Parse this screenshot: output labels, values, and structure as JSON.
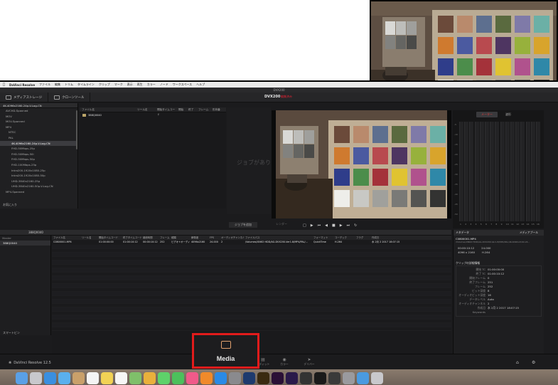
{
  "menubar": {
    "app": "DaVinci Resolve",
    "items": [
      "ファイル",
      "編集",
      "トリム",
      "タイムライン",
      "クリップ",
      "マーク",
      "表示",
      "再生",
      "カラー",
      "ノード",
      "ワークスペース",
      "ヘルプ"
    ]
  },
  "window_title": "DVX200",
  "toolbar": {
    "media_storage": "メディアストレージ",
    "clone_tool": "クローンツール",
    "project_name": "DVX200",
    "project_status": "編集済み"
  },
  "tree": {
    "header": "4K-4096x2160-24p-V-Log-CN",
    "items": [
      {
        "label": "AVCHD-Spanned",
        "indent": 1
      },
      {
        "label": "MOV",
        "indent": 1
      },
      {
        "label": "MOV-Spanned",
        "indent": 1
      },
      {
        "label": "MP4",
        "indent": 1
      },
      {
        "label": "NTSC",
        "indent": 2
      },
      {
        "label": "PAL",
        "indent": 2
      },
      {
        "label": "4K-4096x2160-24p-V-Log-CN",
        "indent": 3,
        "selected": true
      },
      {
        "label": "FHD-50Mbps-25p",
        "indent": 3
      },
      {
        "label": "FHD-50Mbps-50i",
        "indent": 3
      },
      {
        "label": "FHD-50Mbps-50p",
        "indent": 3
      },
      {
        "label": "FHD-100Mbps-25p",
        "indent": 3
      },
      {
        "label": "Intra200-1920x1080-25p",
        "indent": 3
      },
      {
        "label": "Intra200-1920x1080-50p",
        "indent": 3
      },
      {
        "label": "UHD-3840x2160-25p",
        "indent": 3
      },
      {
        "label": "UHD-3840x2160-50p-V-Log-CN",
        "indent": 3
      },
      {
        "label": "MP4-Spanned",
        "indent": 1
      }
    ],
    "favorites": "お気に入り"
  },
  "files": {
    "columns": [
      "ファイル名",
      "ツール名",
      "開始タイムコード",
      "開始",
      "終了",
      "フレーム",
      "形状番"
    ],
    "rows": [
      {
        "name": "388Q0040"
      }
    ]
  },
  "jobs": {
    "empty_text": "ジョブがあり",
    "add_job": "ジョブを追加",
    "render": "レンダー"
  },
  "meters": {
    "tab_meter": "メーター",
    "tab_waveform": "波形",
    "scale": [
      "-5",
      "-10",
      "-15",
      "-20",
      "-25",
      "-30",
      "-35",
      "-40",
      "-45",
      "-50"
    ],
    "channels": [
      "1",
      "2",
      "3",
      "4",
      "5",
      "6",
      "7",
      "8",
      "9",
      "10",
      "11",
      "12",
      "13",
      "14",
      "15",
      "16"
    ]
  },
  "binbar": {
    "bin": "388Q0040",
    "master": "Master"
  },
  "clips": {
    "columns": [
      "ファイル名",
      "リール名",
      "開始タイムコード",
      "終了タイムコード",
      "継続時間",
      "フレーム",
      "種類",
      "解像度",
      "FPS",
      "オーディオチャンネル",
      "ファイルパス",
      "フォーマット",
      "コーデック",
      "フラグ",
      "作成日"
    ],
    "row": [
      "C0800001.MP4",
      "",
      "01:00:00:00",
      "01:00:10:12",
      "00:00:10:12",
      "252",
      "ビデオ+オーディ...",
      "4096x2160",
      "24.000",
      "2",
      "/Volumes/UNKO HDD/AG-DVX200-Ver1.8/MP4/PAL/...",
      "QuickTime",
      "H.264",
      "",
      "水 2月 2 2017 18:07:15"
    ],
    "smart_bin": "スマートビン"
  },
  "meta": {
    "tab_metadata": "メタデータ",
    "tab_media_pool": "メディアプール",
    "clip_name": "C0800001.MP4",
    "clip_path": "/Volumes/UNKO HDD/AG-DVX200-Ver1.8/MP4/PAL/4K-4096x2160-24...",
    "fields": [
      {
        "k": "00:00:10:12",
        "v": "24.000"
      },
      {
        "k": "4096 x 2160",
        "v": "H.264"
      }
    ],
    "section": "クリップの詳細情報",
    "details": [
      {
        "k": "開始 TC",
        "v": "01:00:00:00"
      },
      {
        "k": "終了 TC",
        "v": "01:00:10:12"
      },
      {
        "k": "開始フレーム",
        "v": "0"
      },
      {
        "k": "終了フレーム",
        "v": "251"
      },
      {
        "k": "フレーム",
        "v": "252"
      },
      {
        "k": "ビット深度",
        "v": "8"
      },
      {
        "k": "オーディオビット深度",
        "v": "16"
      },
      {
        "k": "データレベル",
        "v": "Auto"
      },
      {
        "k": "オーディオチャンネル",
        "v": "2"
      },
      {
        "k": "作成日",
        "v": "水 2月 2 2017 18:07:15"
      },
      {
        "k": "Keywords",
        "v": ""
      }
    ]
  },
  "pagenav": {
    "brand": "DaVinci Resolve 12.5",
    "media": "Media",
    "edit": "エディット",
    "color": "カラー",
    "deliver": "デリバー"
  },
  "colors": {
    "highlight": "#e21b1b",
    "arrow": "#4a86c8",
    "meter_tab": "#e03a3a"
  },
  "dock_icons": [
    "finder-icon",
    "launchpad-icon",
    "safari-icon",
    "mail-icon",
    "contacts-icon",
    "calendar-icon",
    "notes-icon",
    "reminders-icon",
    "maps-icon",
    "photos-icon",
    "messages-icon",
    "facetime-icon",
    "itunes-icon",
    "ibooks-icon",
    "app-store-icon",
    "system-preferences-icon",
    "photoshop-icon",
    "illustrator-icon",
    "premiere-icon",
    "after-effects-icon",
    "resolve-icon",
    "terminal-icon",
    "activity-monitor-icon",
    "disk-utility-icon",
    "folder-icon",
    "trash-icon"
  ]
}
